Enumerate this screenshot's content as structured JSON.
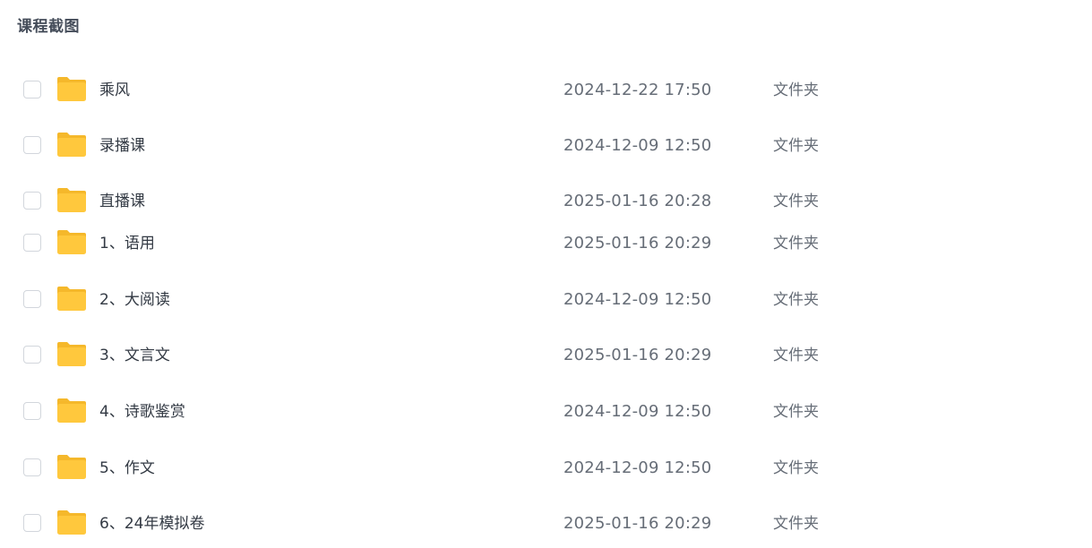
{
  "title": "课程截图",
  "folder_icon": "folder-icon",
  "colors": {
    "folder_body": "#FFC83D",
    "folder_tab": "#F5B82B",
    "checkbox_border": "#D2D6DC",
    "title_text": "#454D5A",
    "name_text": "#333A44",
    "meta_text": "#666D77"
  },
  "files": [
    {
      "name": "乘风",
      "date": "2024-12-22 17:50",
      "type": "文件夹"
    },
    {
      "name": "录播课",
      "date": "2024-12-09 12:50",
      "type": "文件夹"
    },
    {
      "name": "直播课",
      "date": "2025-01-16 20:28",
      "type": "文件夹"
    },
    {
      "name": "1、语用",
      "date": "2025-01-16 20:29",
      "type": "文件夹"
    },
    {
      "name": "2、大阅读",
      "date": "2024-12-09 12:50",
      "type": "文件夹"
    },
    {
      "name": "3、文言文",
      "date": "2025-01-16 20:29",
      "type": "文件夹"
    },
    {
      "name": "4、诗歌鉴赏",
      "date": "2024-12-09 12:50",
      "type": "文件夹"
    },
    {
      "name": "5、作文",
      "date": "2024-12-09 12:50",
      "type": "文件夹"
    },
    {
      "name": "6、24年模拟卷",
      "date": "2025-01-16 20:29",
      "type": "文件夹"
    }
  ]
}
